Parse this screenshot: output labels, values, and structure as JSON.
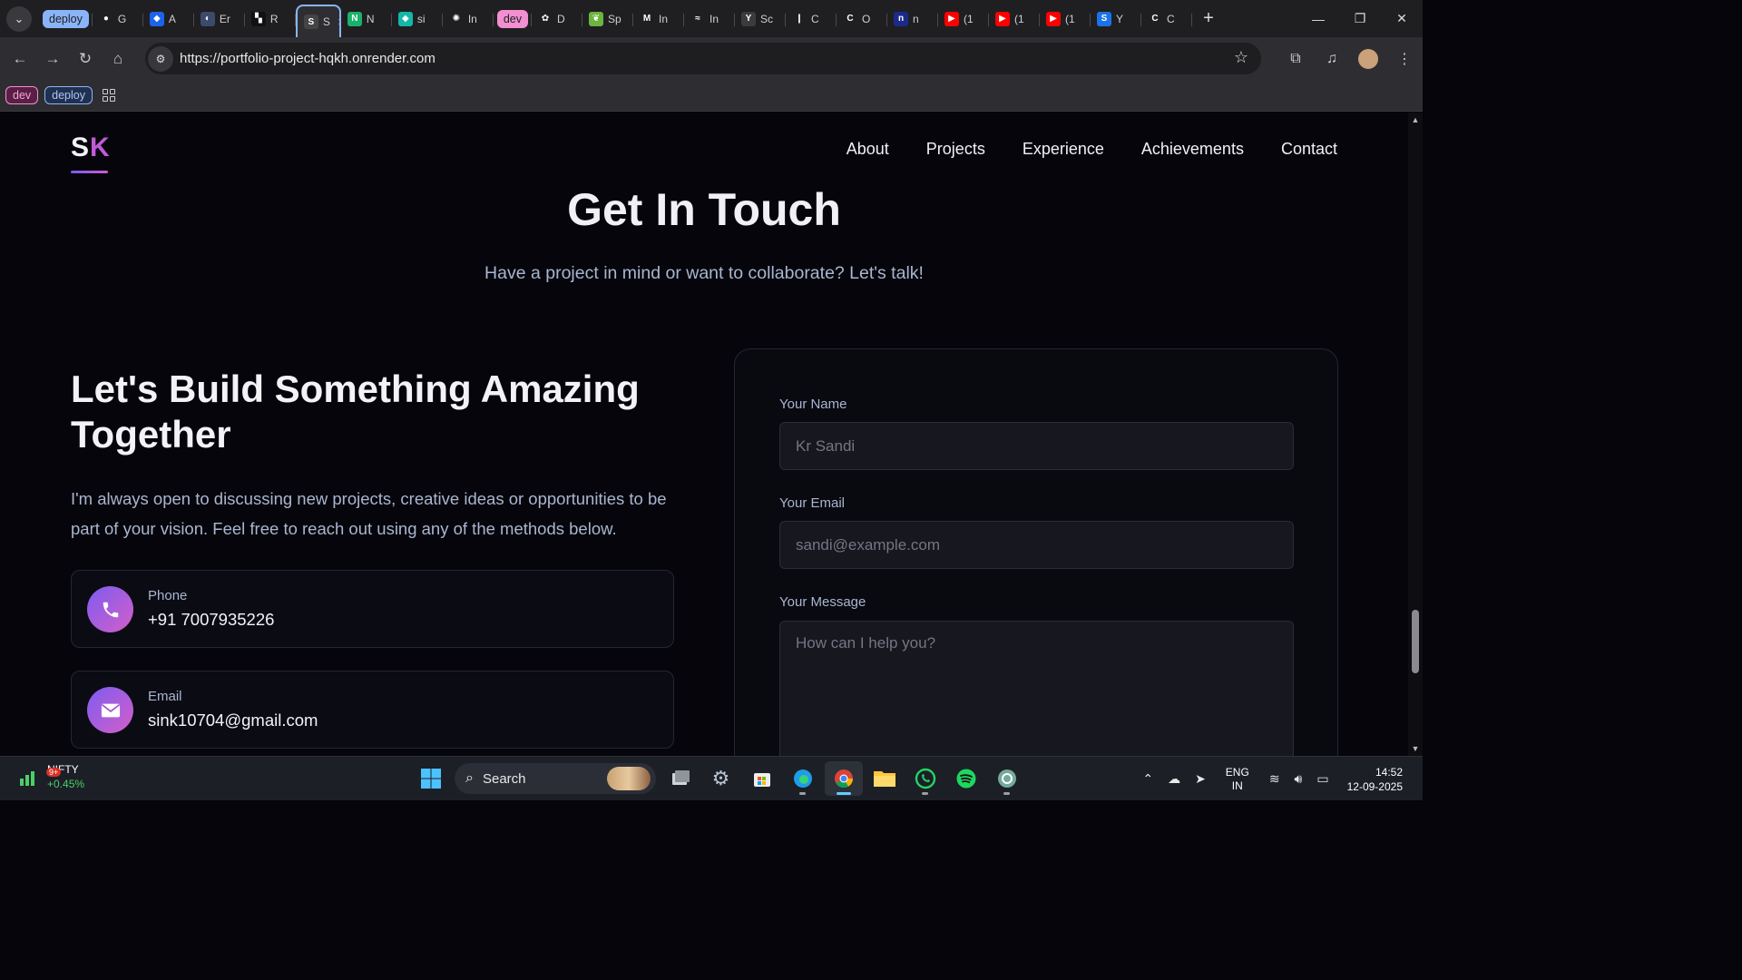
{
  "browser": {
    "tabs": [
      {
        "type": "group",
        "label": "deploy",
        "color": "#8ab4f8",
        "text_color": "#202124"
      },
      {
        "label": "G",
        "icon": "github-icon",
        "icon_bg": "#1f1f22",
        "icon_glyph": "●"
      },
      {
        "label": "A",
        "icon": "docker-icon",
        "icon_bg": "#1d63ed",
        "icon_glyph": "◆"
      },
      {
        "label": "Er",
        "icon": "globe-icon",
        "icon_bg": "#3c4a6b",
        "icon_glyph": "◐"
      },
      {
        "label": "R",
        "icon": "render-icon",
        "icon_bg": "#111",
        "icon_glyph": "▚"
      },
      {
        "label": "S",
        "icon": "page-icon",
        "icon_bg": "#444",
        "icon_glyph": "S",
        "active": true
      },
      {
        "label": "N",
        "icon": "n-icon",
        "icon_bg": "#1ab26b",
        "icon_glyph": "N"
      },
      {
        "label": "si",
        "icon": "diamond-icon",
        "icon_bg": "#14b8a6",
        "icon_glyph": "◆"
      },
      {
        "label": "In",
        "icon": "react-icon",
        "icon_bg": "#1f1f22",
        "icon_glyph": "✺"
      },
      {
        "type": "group",
        "label": "dev",
        "color": "#f28fd1",
        "text_color": "#202124"
      },
      {
        "label": "D",
        "icon": "flower-icon",
        "icon_bg": "#1f1f22",
        "icon_glyph": "✿"
      },
      {
        "label": "Sp",
        "icon": "spring-icon",
        "icon_bg": "#6db33f",
        "icon_glyph": "❦"
      },
      {
        "label": "In",
        "icon": "mui-icon",
        "icon_bg": "#1f1f22",
        "icon_glyph": "M"
      },
      {
        "label": "In",
        "icon": "tailwind-icon",
        "icon_bg": "#1f1f22",
        "icon_glyph": "≈"
      },
      {
        "label": "Sc",
        "icon": "yc-icon",
        "icon_bg": "#3b3b3b",
        "icon_glyph": "Y"
      },
      {
        "label": "C",
        "icon": "mongodb-icon",
        "icon_bg": "#1f1f22",
        "icon_glyph": "❙"
      },
      {
        "label": "O",
        "icon": "circle-c-icon",
        "icon_bg": "#1f1f22",
        "icon_glyph": "C"
      },
      {
        "label": "n",
        "icon": "naukri-icon",
        "icon_bg": "#1b2a8a",
        "icon_glyph": "n"
      },
      {
        "label": "(1",
        "icon": "youtube-icon",
        "icon_bg": "#ff0000",
        "icon_glyph": "▶"
      },
      {
        "label": "(1",
        "icon": "youtube-icon",
        "icon_bg": "#ff0000",
        "icon_glyph": "▶"
      },
      {
        "label": "(1",
        "icon": "youtube-icon",
        "icon_bg": "#ff0000",
        "icon_glyph": "▶"
      },
      {
        "label": "Y",
        "icon": "s-icon",
        "icon_bg": "#1a73e8",
        "icon_glyph": "S"
      },
      {
        "label": "C",
        "icon": "chatgpt-circle-icon",
        "icon_bg": "#1f1f22",
        "icon_glyph": "C"
      }
    ],
    "url": "https://portfolio-project-hqkh.onrender.com",
    "bookmarks": [
      {
        "label": "dev",
        "bg": "#5a1f45",
        "color": "#f5a3d8",
        "border": "#f28fd1"
      },
      {
        "label": "deploy",
        "bg": "#22304f",
        "color": "#a8c7fa",
        "border": "#8ab4f8"
      }
    ]
  },
  "site": {
    "logo_s": "S",
    "logo_k": "K",
    "nav": [
      "About",
      "Projects",
      "Experience",
      "Achievements",
      "Contact"
    ],
    "section_title": "Get In Touch",
    "section_subtitle": "Have a project in mind or want to collaborate? Let's talk!",
    "heading": "Let's Build Something Amazing Together",
    "intro": "I'm always open to discussing new projects, creative ideas or opportunities to be part of your vision. Feel free to reach out using any of the methods below.",
    "contacts": [
      {
        "label": "Phone",
        "value": "+91 7007935226",
        "icon": "phone-icon"
      },
      {
        "label": "Email",
        "value": "sink10704@gmail.com",
        "icon": "mail-icon"
      }
    ],
    "form": {
      "name_label": "Your Name",
      "name_placeholder": "Kr Sandi",
      "email_label": "Your Email",
      "email_placeholder": "sandi@example.com",
      "message_label": "Your Message",
      "message_placeholder": "How can I help you?"
    }
  },
  "taskbar": {
    "widget_badge": "9+",
    "widget_name": "NIFTY",
    "widget_change": "+0.45%",
    "search_label": "Search",
    "lang_top": "ENG",
    "lang_bottom": "IN",
    "time": "14:52",
    "date": "12-09-2025"
  }
}
